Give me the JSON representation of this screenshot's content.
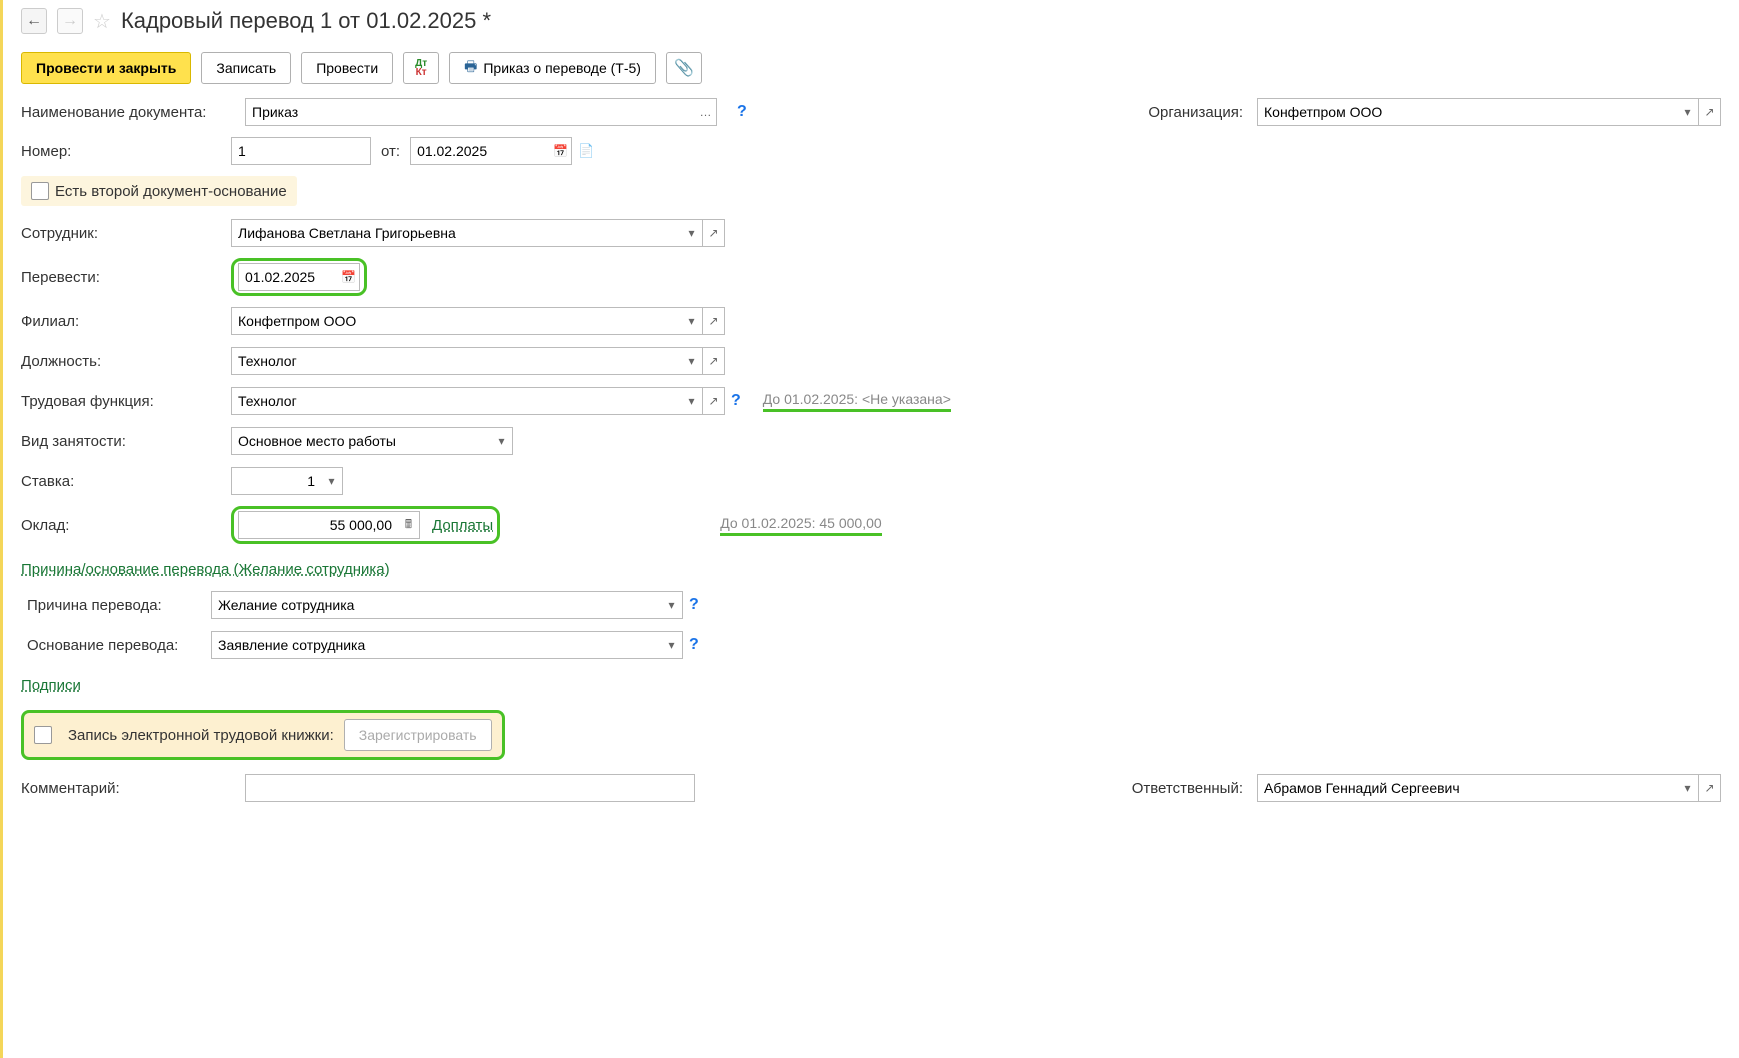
{
  "header": {
    "title": "Кадровый перевод 1 от 01.02.2025 *"
  },
  "toolbar": {
    "save_close": "Провести и закрыть",
    "write": "Записать",
    "post": "Провести",
    "print_order": "Приказ о переводе (Т-5)"
  },
  "fields": {
    "doc_name_label": "Наименование документа:",
    "doc_name_value": "Приказ",
    "org_label": "Организация:",
    "org_value": "Конфетпром ООО",
    "number_label": "Номер:",
    "number_value": "1",
    "from_label": "от:",
    "date_value": "01.02.2025",
    "second_doc_label": "Есть второй документ-основание",
    "employee_label": "Сотрудник:",
    "employee_value": "Лифанова Светлана Григорьевна",
    "transfer_label": "Перевести:",
    "transfer_value": "01.02.2025",
    "branch_label": "Филиал:",
    "branch_value": "Конфетпром ООО",
    "position_label": "Должность:",
    "position_value": "Технолог",
    "func_label": "Трудовая функция:",
    "func_value": "Технолог",
    "func_info": "До 01.02.2025: <Не указана>",
    "emp_type_label": "Вид занятости:",
    "emp_type_value": "Основное место работы",
    "rate_label": "Ставка:",
    "rate_value": "1",
    "salary_label": "Оклад:",
    "salary_value": "55 000,00",
    "dop_link": "Доплаты",
    "salary_info": "До 01.02.2025: 45 000,00",
    "reason_link": "Причина/основание перевода (Желание сотрудника)",
    "reason_label": "Причина перевода:",
    "reason_value": "Желание сотрудника",
    "basis_label": "Основание перевода:",
    "basis_value": "Заявление сотрудника",
    "sign_link": "Подписи",
    "etk_label": "Запись электронной трудовой книжки:",
    "etk_btn": "Зарегистрировать",
    "comment_label": "Комментарий:",
    "comment_value": "",
    "resp_label": "Ответственный:",
    "resp_value": "Абрамов Геннадий Сергеевич"
  }
}
